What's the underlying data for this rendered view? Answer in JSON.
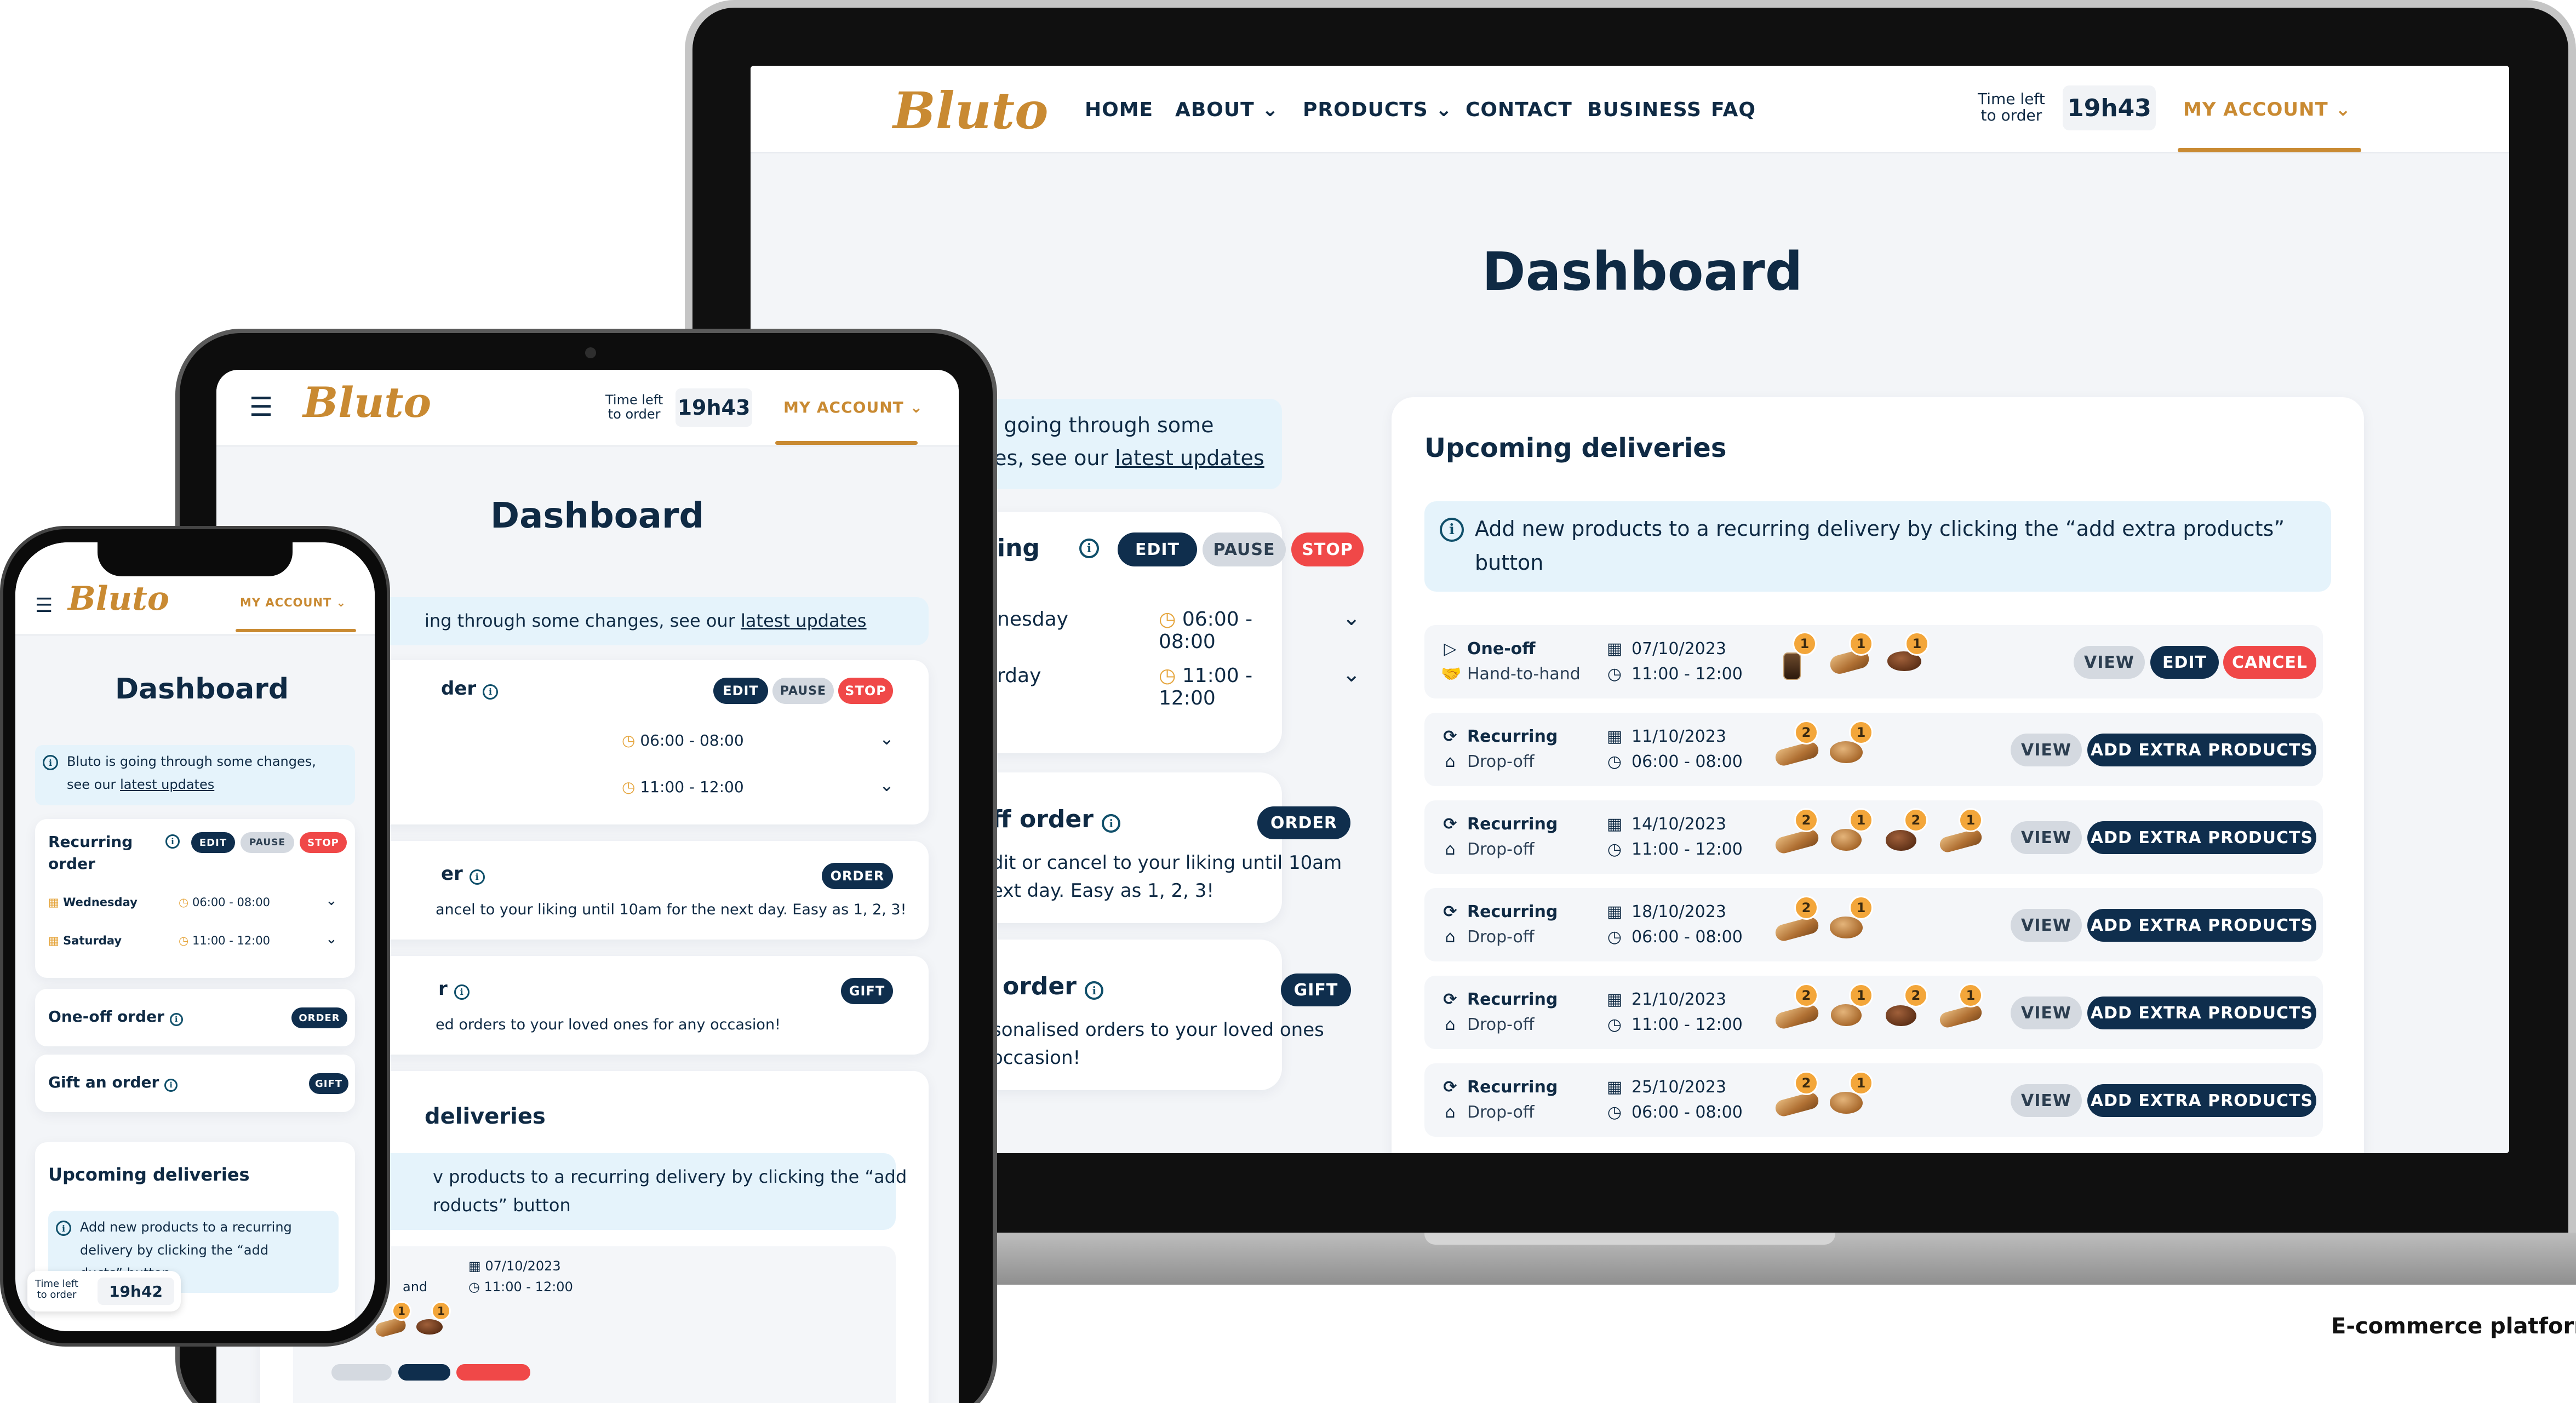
{
  "brand": {
    "logo": "Bluto",
    "accent": "#c98a32",
    "navy": "#0f2e4d",
    "danger": "#f04848"
  },
  "nav": {
    "items": [
      "HOME",
      "ABOUT",
      "PRODUCTS",
      "CONTACT",
      "BUSINESS",
      "FAQ"
    ],
    "time_label_1": "Time left",
    "time_label_2": "to order",
    "time_value": "19h43",
    "account": "MY ACCOUNT"
  },
  "dashboard": {
    "title": "Dashboard",
    "notice_part": "is going through some",
    "notice_part2": "ges, see our",
    "notice_link": "latest updates",
    "recurring": {
      "title": "Recurring order",
      "title_short": "ing",
      "edit": "EDIT",
      "pause": "PAUSE",
      "stop": "STOP",
      "day1": "Wednesday",
      "day1_short": "nesday",
      "time1": "06:00 - 08:00",
      "day2": "Saturday",
      "day2_short": "rday",
      "time2": "11:00 - 12:00"
    },
    "oneoff": {
      "title": "One-off order",
      "title_short": "ff order",
      "button": "ORDER",
      "desc_l1": "dit or cancel to your liking until 10am",
      "desc_l2": "ext day. Easy as 1, 2, 3!"
    },
    "gift": {
      "title": "Gift an order",
      "title_short": "order",
      "button": "GIFT",
      "desc_l1": "sonalised orders to your loved ones",
      "desc_l2": "occasion!"
    }
  },
  "upcoming": {
    "title": "Upcoming deliveries",
    "info_l1": "Add new products to a recurring delivery by clicking the “add extra products”",
    "info_l2": "button",
    "view": "VIEW",
    "edit": "EDIT",
    "cancel": "CANCEL",
    "add_extra": "ADD EXTRA PRODUCTS",
    "rows": [
      {
        "type": "One-off",
        "method": "Hand-to-hand",
        "date": "07/10/2023",
        "time": "11:00 - 12:00"
      },
      {
        "type": "Recurring",
        "method": "Drop-off",
        "date": "11/10/2023",
        "time": "06:00 - 08:00"
      },
      {
        "type": "Recurring",
        "method": "Drop-off",
        "date": "14/10/2023",
        "time": "11:00 - 12:00"
      },
      {
        "type": "Recurring",
        "method": "Drop-off",
        "date": "18/10/2023",
        "time": "06:00 - 08:00"
      },
      {
        "type": "Recurring",
        "method": "Drop-off",
        "date": "21/10/2023",
        "time": "11:00 - 12:00"
      },
      {
        "type": "Recurring",
        "method": "Drop-off",
        "date": "25/10/2023",
        "time": "06:00 - 08:00"
      }
    ],
    "badge_1": "1",
    "badge_2": "2"
  },
  "tablet": {
    "notice": "ing through some changes, see our",
    "recurring_title": "der",
    "oneoff_title": "er",
    "oneoff_desc": "ancel to your liking until 10am for the next day. Easy as 1, 2, 3!",
    "gift_title": "r",
    "gift_desc": "ed orders to your loved ones for any occasion!",
    "upcoming_title": "deliveries",
    "info_l1": "v products to a recurring delivery by clicking the “add",
    "info_l2": "roducts” button",
    "row_method": "and"
  },
  "phone": {
    "notice_l1": "Bluto is going through some changes,",
    "notice_l2": "see our",
    "recurring_l1": "Recurring",
    "recurring_l2": "order",
    "info_l1": "Add new products to a recurring",
    "info_l2": "delivery by clicking the “add",
    "info_l3": "ducts” button",
    "time_value": "19h42"
  },
  "caption": "E-commerce platform"
}
